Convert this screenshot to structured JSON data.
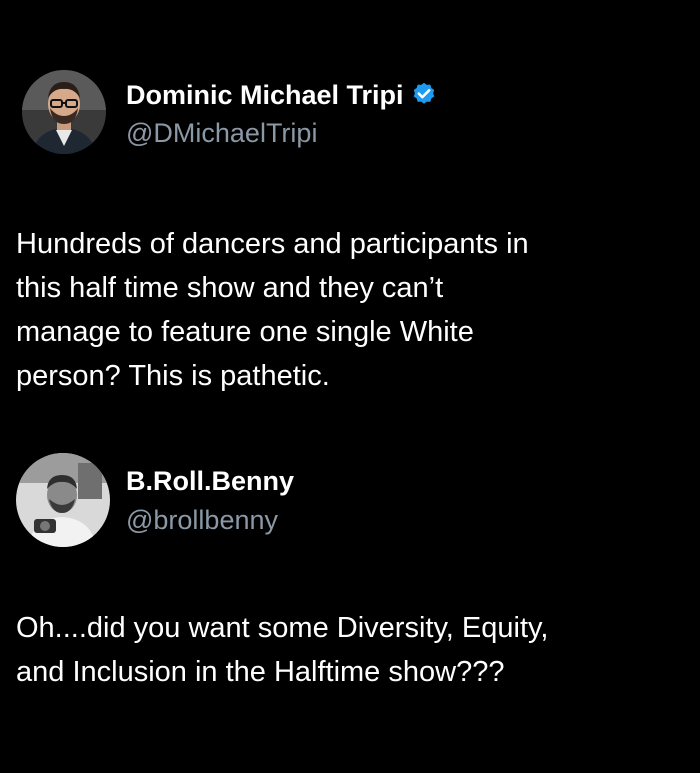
{
  "tweet1": {
    "display_name": "Dominic Michael Tripi",
    "handle": "@DMichaelTripi",
    "verified_icon": "verified-badge-icon",
    "verified_color": "#1d9bf0",
    "lines": [
      "Hundreds of dancers and participants in",
      "this half time show and they can’t",
      "manage to feature one single White",
      "person? This is pathetic."
    ]
  },
  "tweet2": {
    "display_name": "B.Roll.Benny",
    "handle": "@brollbenny",
    "lines": [
      "Oh....did you want some Diversity, Equity,",
      "and Inclusion in the Halftime show???"
    ]
  }
}
